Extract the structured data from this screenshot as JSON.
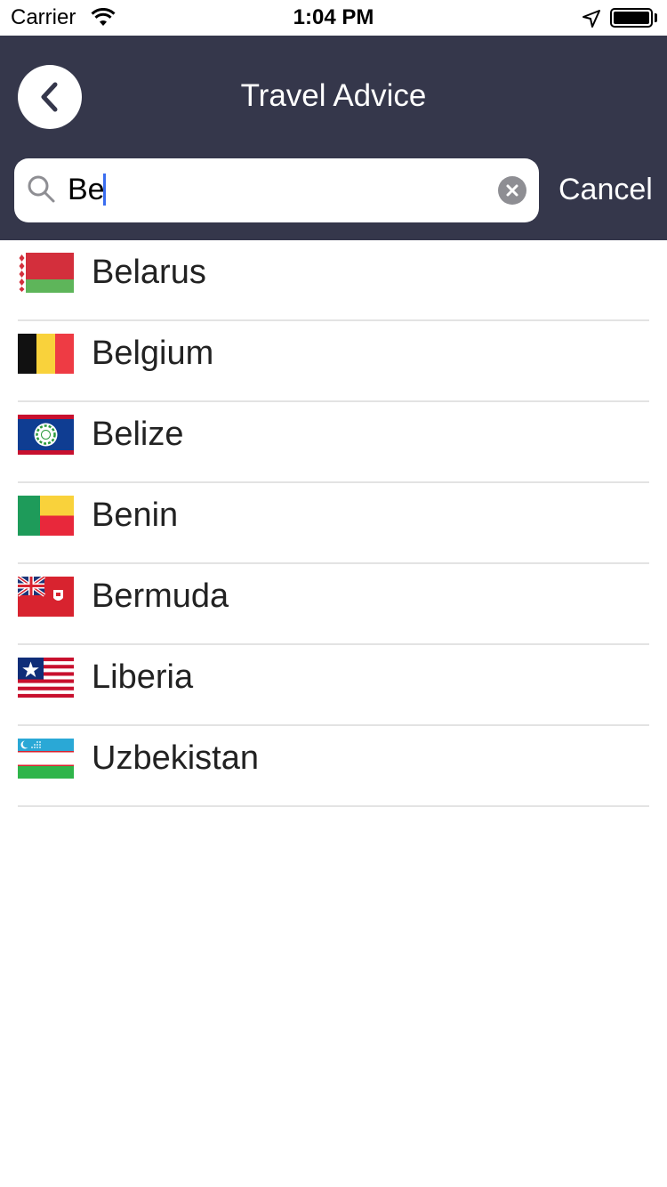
{
  "status_bar": {
    "carrier": "Carrier",
    "time": "1:04 PM"
  },
  "header": {
    "title": "Travel Advice",
    "back_icon": "chevron-left-icon"
  },
  "search": {
    "value": "Be",
    "cancel_label": "Cancel"
  },
  "colors": {
    "nav_bar": "#35374b",
    "caret": "#3a6df0",
    "divider": "#e3e3e3"
  },
  "countries": [
    {
      "name": "Belarus",
      "flag": "belarus-flag-icon"
    },
    {
      "name": "Belgium",
      "flag": "belgium-flag-icon"
    },
    {
      "name": "Belize",
      "flag": "belize-flag-icon"
    },
    {
      "name": "Benin",
      "flag": "benin-flag-icon"
    },
    {
      "name": "Bermuda",
      "flag": "bermuda-flag-icon"
    },
    {
      "name": "Liberia",
      "flag": "liberia-flag-icon"
    },
    {
      "name": "Uzbekistan",
      "flag": "uzbekistan-flag-icon"
    }
  ]
}
